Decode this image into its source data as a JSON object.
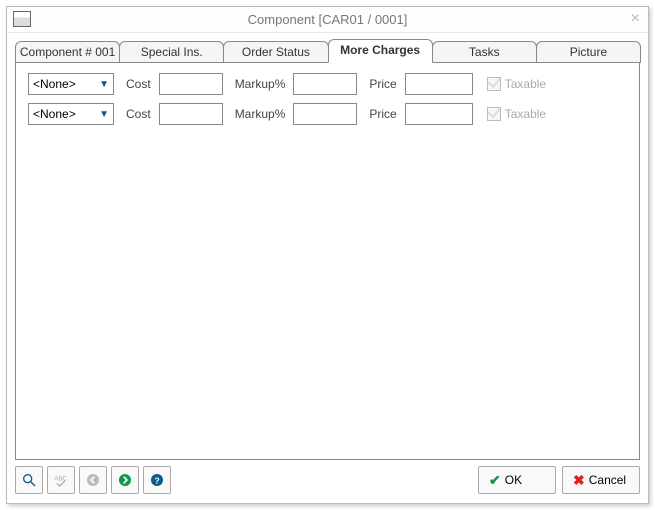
{
  "window": {
    "title": "Component [CAR01 / 0001]"
  },
  "tabs": [
    {
      "label": "Component # 001"
    },
    {
      "label": "Special Ins."
    },
    {
      "label": "Order Status"
    },
    {
      "label": "More Charges"
    },
    {
      "label": "Tasks"
    },
    {
      "label": "Picture"
    }
  ],
  "active_tab": 3,
  "charges": {
    "labels": {
      "cost": "Cost",
      "markup": "Markup%",
      "price": "Price",
      "taxable": "Taxable"
    },
    "rows": [
      {
        "type": "<None>",
        "cost": "",
        "markup": "",
        "price": "",
        "taxable": false
      },
      {
        "type": "<None>",
        "cost": "",
        "markup": "",
        "price": "",
        "taxable": false
      }
    ]
  },
  "icons": {
    "search": "search-icon",
    "spell": "spellcheck-icon",
    "back": "back-icon",
    "forward": "forward-icon",
    "help": "help-icon"
  },
  "buttons": {
    "ok": "OK",
    "cancel": "Cancel"
  }
}
